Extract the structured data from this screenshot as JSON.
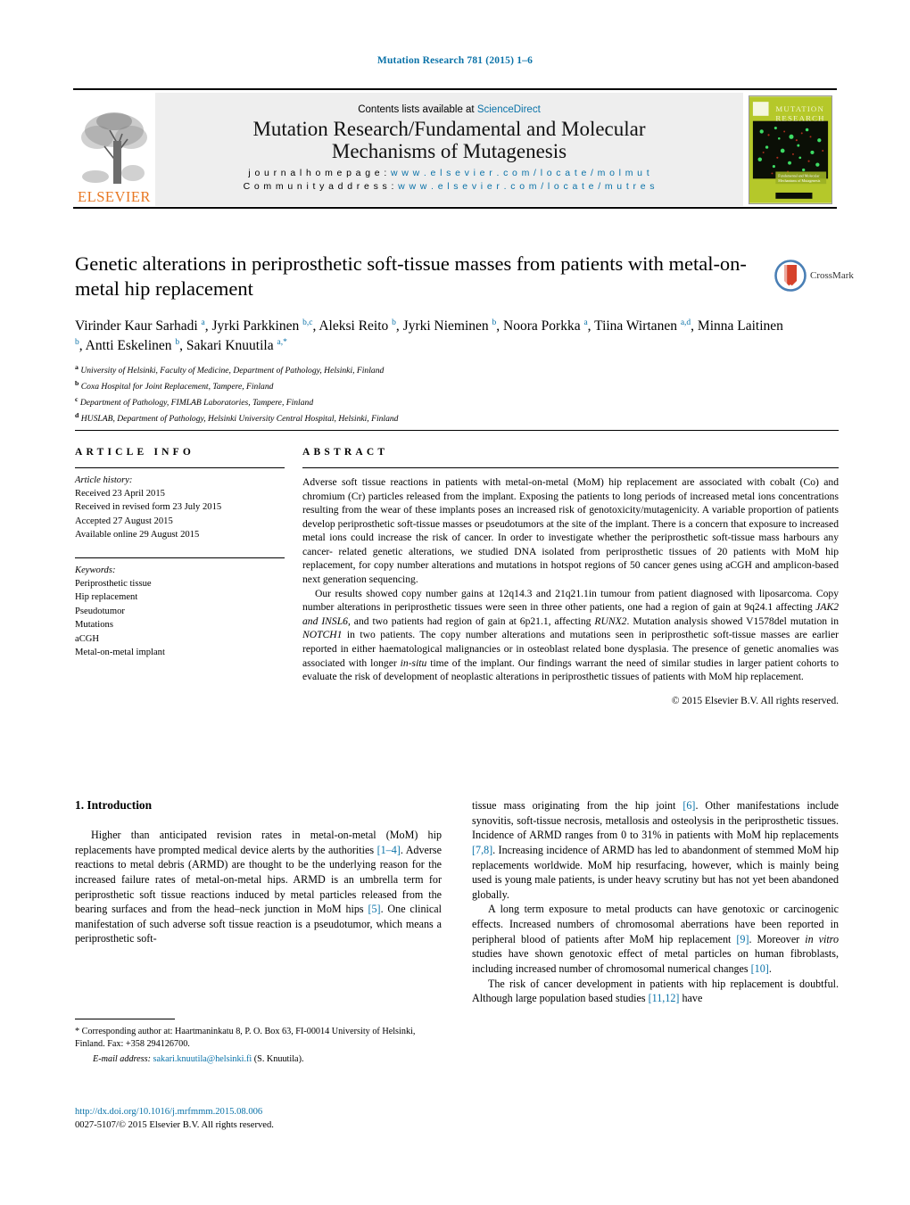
{
  "running_head": "Mutation Research 781 (2015) 1–6",
  "masthead": {
    "publisher": "ELSEVIER",
    "contents_prefix": "Contents lists available at ",
    "contents_link": "ScienceDirect",
    "journal_title_line1": "Mutation Research/Fundamental and Molecular",
    "journal_title_line2": "Mechanisms of Mutagenesis",
    "homepage_label": "j o u r n a l   h o m e p a g e :",
    "homepage_url": "w w w . e l s e v i e r . c o m / l o c a t e / m o l m u t",
    "community_label": "C o m m u n i t y   a d d r e s s :",
    "community_url": "w w w . e l s e v i e r . c o m / l o c a t e / m u t r e s",
    "cover_title_line1": "MUTATION",
    "cover_title_line2": "RESEARCH",
    "cover_subtitle": "Fundamental and Molecular Mechanisms of Mutagenesis"
  },
  "article": {
    "title": "Genetic alterations in periprosthetic soft-tissue masses from patients with metal-on-metal hip replacement",
    "crossmark_label": "CrossMark",
    "authors_html": "Virinder Kaur Sarhadi <sup>a</sup>, Jyrki Parkkinen <sup>b,c</sup>, Aleksi Reito <sup>b</sup>, Jyrki Nieminen <sup>b</sup>, Noora Porkka <sup>a</sup>, Tiina Wirtanen <sup>a,d</sup>, Minna Laitinen <sup>b</sup>, Antti Eskelinen <sup>b</sup>, Sakari Knuutila <sup>a,*</sup>",
    "affiliations": [
      {
        "marker": "a",
        "text": "University of Helsinki, Faculty of Medicine, Department of Pathology, Helsinki, Finland"
      },
      {
        "marker": "b",
        "text": "Coxa Hospital for Joint Replacement, Tampere, Finland"
      },
      {
        "marker": "c",
        "text": "Department of Pathology, FIMLAB Laboratories, Tampere, Finland"
      },
      {
        "marker": "d",
        "text": "HUSLAB, Department of Pathology, Helsinki University Central Hospital, Helsinki, Finland"
      }
    ]
  },
  "article_info": {
    "heading": "ARTICLE INFO",
    "history_label": "Article history:",
    "history": [
      "Received 23 April 2015",
      "Received in revised form 23 July 2015",
      "Accepted 27 August 2015",
      "Available online 29 August 2015"
    ],
    "keywords_label": "Keywords:",
    "keywords": [
      "Periprosthetic tissue",
      "Hip replacement",
      "Pseudotumor",
      "Mutations",
      "aCGH",
      "Metal-on-metal implant"
    ]
  },
  "abstract": {
    "heading": "ABSTRACT",
    "paragraph1": "Adverse soft tissue reactions in patients with metal-on-metal (MoM) hip replacement are associated with cobalt (Co) and chromium (Cr) particles released from the implant. Exposing the patients to long periods of increased metal ions concentrations resulting from the wear of these implants poses an increased risk of genotoxicity/mutagenicity. A variable proportion of patients develop periprosthetic soft-tissue masses or pseudotumors at the site of the implant. There is a concern that exposure to increased metal ions could increase the risk of cancer. In order to investigate whether the periprosthetic soft-tissue mass harbours any cancer- related genetic alterations, we studied DNA isolated from periprosthetic tissues of 20 patients with MoM hip replacement, for copy number alterations and mutations in hotspot regions of 50 cancer genes using aCGH and amplicon-based next generation sequencing.",
    "paragraph2_html": "Our results showed copy number gains at 12q14.3 and 21q21.1in tumour from patient diagnosed with liposarcoma. Copy number alterations in periprosthetic tissues were seen in three other patients, one had a region of gain at 9q24.1 affecting <i>JAK2 and INSL6</i>, and two patients had region of gain at 6p21.1, affecting <i>RUNX2</i>. Mutation analysis showed V1578del mutation in <i>NOTCH1</i> in two patients. The copy number alterations and mutations seen in periprosthetic soft-tissue masses are earlier reported in either haematological malignancies or in osteoblast related bone dysplasia. The presence of genetic anomalies was associated with longer <i>in-situ</i> time of the implant. Our findings warrant the need of similar studies in larger patient cohorts to evaluate the risk of development of neoplastic alterations in periprosthetic tissues of patients with MoM hip replacement.",
    "copyright": "© 2015 Elsevier B.V. All rights reserved."
  },
  "introduction": {
    "section_number_title": "1.  Introduction",
    "left_paragraph_html": "Higher than anticipated revision rates in metal-on-metal (MoM) hip replacements have prompted medical device alerts by the authorities <span class=\"ref\">[1–4]</span>. Adverse reactions to metal debris (ARMD) are thought to be the underlying reason for the increased failure rates of metal-on-metal hips. ARMD is an umbrella term for periprosthetic soft tissue reactions induced by metal particles released from the bearing surfaces and from the head–neck junction in MoM hips <span class=\"ref\">[5]</span>. One clinical manifestation of such adverse soft tissue reaction is a pseudotumor, which means a periprosthetic soft-",
    "right_paragraph1_html": "tissue mass originating from the hip joint <span class=\"ref\">[6]</span>. Other manifestations include synovitis, soft-tissue necrosis, metallosis and osteolysis in the periprosthetic tissues. Incidence of ARMD ranges from 0 to 31% in patients with MoM hip replacements <span class=\"ref\">[7,8]</span>. Increasing incidence of ARMD has led to abandonment of stemmed MoM hip replacements worldwide. MoM hip resurfacing, however, which is mainly being used is young male patients, is under heavy scrutiny but has not yet been abandoned globally.",
    "right_paragraph2_html": "A long term exposure to metal products can have genotoxic or carcinogenic effects. Increased numbers of chromosomal aberrations have been reported in peripheral blood of patients after MoM hip replacement <span class=\"ref\">[9]</span>. Moreover <i>in vitro</i> studies have shown genotoxic effect of metal particles on human fibroblasts, including increased number of chromosomal numerical changes <span class=\"ref\">[10]</span>.",
    "right_paragraph3_html": "The risk of cancer development in patients with hip replacement is doubtful. Although large population based studies <span class=\"ref\">[11,12]</span> have"
  },
  "footer": {
    "corresponding_html": "* Corresponding author at: Haartmaninkatu 8, P. O. Box 63, FI-00014 University of Helsinki, Finland. Fax: +358 294126700.",
    "email_label": "E-mail address:",
    "email_address": "sakari.knuutila@helsinki.fi",
    "email_suffix": " (S. Knuutila).",
    "doi_url": "http://dx.doi.org/10.1016/j.mrfmmm.2015.08.006",
    "issn_line": "0027-5107/© 2015 Elsevier B.V. All rights reserved."
  },
  "colors": {
    "link": "#0a72a8",
    "elsevier_orange": "#E87722",
    "band_gray": "#eeeeee"
  }
}
